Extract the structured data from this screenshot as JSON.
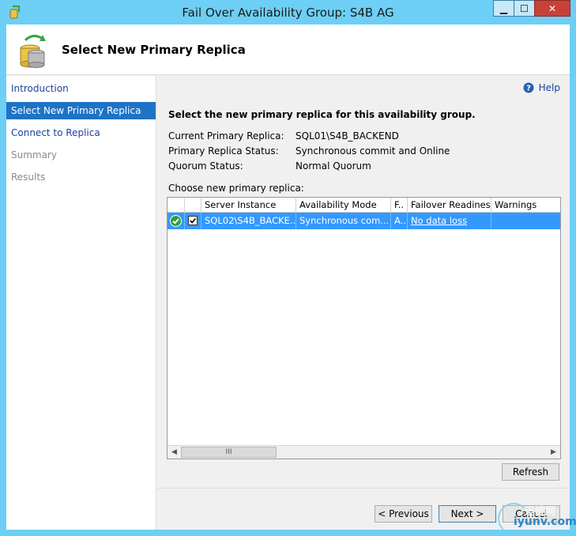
{
  "window": {
    "title": "Fail Over Availability Group: S4B AG",
    "controls": {
      "minimize": "▁",
      "maximize": "☐",
      "close": "✕"
    }
  },
  "header": {
    "title": "Select New Primary Replica",
    "icon": "database-sync-icon"
  },
  "nav": {
    "items": [
      {
        "label": "Introduction",
        "state": "link"
      },
      {
        "label": "Select New Primary Replica",
        "state": "active"
      },
      {
        "label": "Connect to Replica",
        "state": "link"
      },
      {
        "label": "Summary",
        "state": "disabled"
      },
      {
        "label": "Results",
        "state": "disabled"
      }
    ]
  },
  "help": {
    "label": "Help",
    "icon": "help-icon"
  },
  "main": {
    "instruction": "Select the new primary replica for this availability group.",
    "info": [
      {
        "label": "Current Primary Replica:",
        "value": "SQL01\\S4B_BACKEND"
      },
      {
        "label": "Primary Replica Status:",
        "value": "Synchronous commit and Online"
      },
      {
        "label": "Quorum Status:",
        "value": "Normal Quorum"
      }
    ],
    "choose_label": "Choose new primary replica:"
  },
  "grid": {
    "columns": [
      "",
      "",
      "Server Instance",
      "Availability Mode",
      "F..",
      "Failover Readiness",
      "Warnings"
    ],
    "rows": [
      {
        "status_icon": "ok-check-icon",
        "checked": true,
        "server_instance": "SQL02\\S4B_BACKE...",
        "availability_mode": "Synchronous com...",
        "failover": "A...",
        "failover_readiness": "No data loss",
        "warnings": ""
      }
    ],
    "scroll_thumb": "III"
  },
  "buttons": {
    "refresh": "Refresh",
    "previous": "< Previous",
    "next": "Next >",
    "cancel": "Cancel"
  },
  "watermark": {
    "top": "运维网",
    "bottom": "iyunv.com"
  },
  "colors": {
    "titlebar": "#6dcff6",
    "selection": "#3399ff",
    "nav_active": "#1e73c5",
    "link": "#1c3fa0"
  }
}
